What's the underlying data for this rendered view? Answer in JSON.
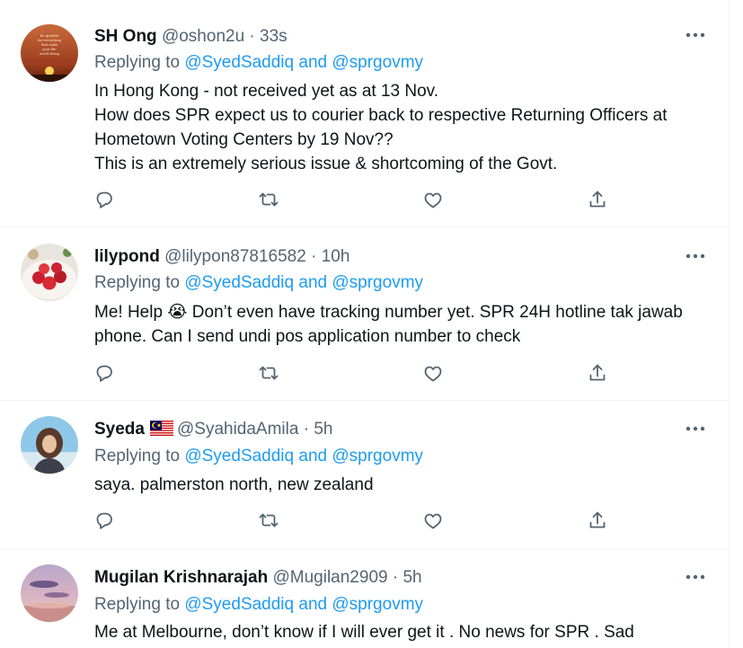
{
  "tweets": [
    {
      "name": "SH Ong",
      "handle": "@oshon2u",
      "time": "33s",
      "replying_prefix": "Replying to",
      "mention1": "@SyedSaddiq",
      "conj": "and",
      "mention2": "@sprgovmy",
      "lines": [
        "In Hong Kong - not received yet as at 13 Nov.",
        "How does SPR expect us to courier back to respective Returning Officers at",
        "Hometown Voting Centers by 19 Nov??",
        "This is an extremely serious issue & shortcoming of the Govt."
      ],
      "avatar_text": [
        "Be grateful",
        "for everything",
        "that make",
        "your life",
        "worth living"
      ]
    },
    {
      "name": "lilypond",
      "handle": "@lilypon87816582",
      "time": "10h",
      "replying_prefix": "Replying to",
      "mention1": "@SyedSaddiq",
      "conj": "and",
      "mention2": "@sprgovmy",
      "lines": [
        "Me! Help 😭 Don’t even have tracking number yet. SPR 24H hotline tak jawab",
        "phone. Can I send undi pos application number to check"
      ]
    },
    {
      "name": "Syeda",
      "handle": "@SyahidaAmila",
      "time": "5h",
      "replying_prefix": "Replying to",
      "mention1": "@SyedSaddiq",
      "conj": "and",
      "mention2": "@sprgovmy",
      "lines": [
        "saya. palmerston north, new zealand"
      ]
    },
    {
      "name": "Mugilan Krishnarajah",
      "handle": "@Mugilan2909",
      "time": "5h",
      "replying_prefix": "Replying to",
      "mention1": "@SyedSaddiq",
      "conj": "and",
      "mention2": "@sprgovmy",
      "lines": [
        "Me at Melbourne, don’t know if I will ever get it . No news for SPR . Sad"
      ]
    }
  ],
  "separator": " · ",
  "icons": {
    "reply": "reply-icon",
    "retweet": "retweet-icon",
    "like": "like-icon",
    "share": "share-icon",
    "more": "more-icon",
    "flag": "malaysia-flag-icon"
  },
  "colors": {
    "text": "#0f1419",
    "secondary": "#536471",
    "link": "#1d9bf0",
    "border": "#eff3f4"
  }
}
